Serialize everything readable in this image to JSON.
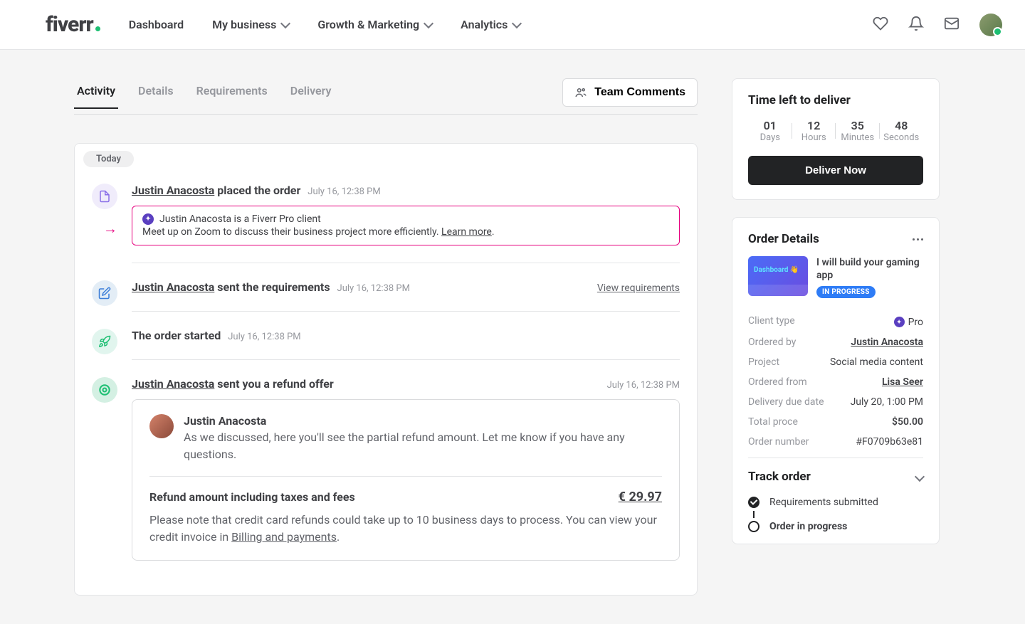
{
  "logo": "fiverr",
  "nav": {
    "dashboard": "Dashboard",
    "my_business": "My business",
    "growth": "Growth & Marketing",
    "analytics": "Analytics"
  },
  "tabs": {
    "activity": "Activity",
    "details": "Details",
    "requirements": "Requirements",
    "delivery": "Delivery"
  },
  "team_comments": "Team Comments",
  "today_chip": "Today",
  "activity": {
    "placed": {
      "user": "Justin Anacosta",
      "action": "placed the order",
      "ts": "July 16, 12:38 PM"
    },
    "pro_banner": {
      "title": "Justin Anacosta is a Fiverr Pro client",
      "sub": "Meet up on Zoom to discuss their business project more efficiently. ",
      "learn_more": "Learn more"
    },
    "requirements": {
      "user": "Justin Anacosta",
      "action": "sent the requirements",
      "ts": "July 16, 12:38 PM",
      "view_link": "View requirements"
    },
    "started": {
      "title": "The order started",
      "ts": "July 16, 12:38 PM"
    },
    "refund": {
      "user": "Justin Anacosta",
      "action": "sent you a refund offer",
      "ts": "July 16, 12:38 PM",
      "msg_name": "Justin Anacosta",
      "msg_body": "As we discussed, here you'll see the partial refund amount. Let me know if you have any questions.",
      "amount_label": "Refund amount including taxes and fees",
      "amount": "€ 29.97",
      "note_before": "Please note that credit card refunds could take up to 10 business days to process. You can view your credit invoice in ",
      "note_link": "Billing and payments",
      "note_after": "."
    }
  },
  "countdown": {
    "heading": "Time left to deliver",
    "days_n": "01",
    "days_l": "Days",
    "hours_n": "12",
    "hours_l": "Hours",
    "mins_n": "35",
    "mins_l": "Minutes",
    "secs_n": "48",
    "secs_l": "Seconds",
    "deliver_btn": "Deliver Now"
  },
  "order_details": {
    "heading": "Order Details",
    "gig_title": "I will build your gaming app",
    "status": "IN PROGRESS",
    "rows": {
      "client_type_k": "Client type",
      "client_type_v": "Pro",
      "ordered_by_k": "Ordered by",
      "ordered_by_v": "Justin Anacosta",
      "project_k": "Project",
      "project_v": "Social media content",
      "ordered_from_k": "Ordered from",
      "ordered_from_v": "Lisa Seer",
      "due_k": "Delivery due date",
      "due_v": "July 20, 1:00 PM",
      "price_k": "Total proce",
      "price_v": "$50.00",
      "ordernum_k": "Order number",
      "ordernum_v": "#F0709b63e81"
    },
    "track_heading": "Track order",
    "track_requirements": "Requirements submitted",
    "track_progress": "Order in progress"
  }
}
